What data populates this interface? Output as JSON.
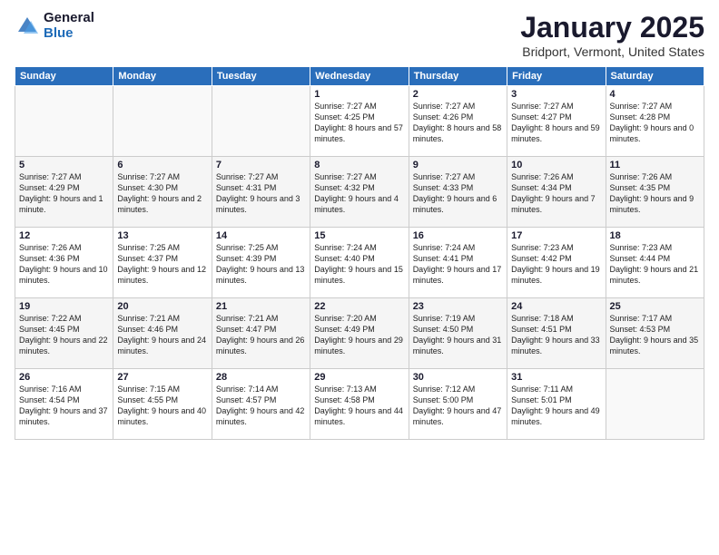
{
  "logo": {
    "general": "General",
    "blue": "Blue"
  },
  "header": {
    "title": "January 2025",
    "subtitle": "Bridport, Vermont, United States"
  },
  "weekdays": [
    "Sunday",
    "Monday",
    "Tuesday",
    "Wednesday",
    "Thursday",
    "Friday",
    "Saturday"
  ],
  "weeks": [
    [
      {
        "day": "",
        "info": ""
      },
      {
        "day": "",
        "info": ""
      },
      {
        "day": "",
        "info": ""
      },
      {
        "day": "1",
        "info": "Sunrise: 7:27 AM\nSunset: 4:25 PM\nDaylight: 8 hours and 57 minutes."
      },
      {
        "day": "2",
        "info": "Sunrise: 7:27 AM\nSunset: 4:26 PM\nDaylight: 8 hours and 58 minutes."
      },
      {
        "day": "3",
        "info": "Sunrise: 7:27 AM\nSunset: 4:27 PM\nDaylight: 8 hours and 59 minutes."
      },
      {
        "day": "4",
        "info": "Sunrise: 7:27 AM\nSunset: 4:28 PM\nDaylight: 9 hours and 0 minutes."
      }
    ],
    [
      {
        "day": "5",
        "info": "Sunrise: 7:27 AM\nSunset: 4:29 PM\nDaylight: 9 hours and 1 minute."
      },
      {
        "day": "6",
        "info": "Sunrise: 7:27 AM\nSunset: 4:30 PM\nDaylight: 9 hours and 2 minutes."
      },
      {
        "day": "7",
        "info": "Sunrise: 7:27 AM\nSunset: 4:31 PM\nDaylight: 9 hours and 3 minutes."
      },
      {
        "day": "8",
        "info": "Sunrise: 7:27 AM\nSunset: 4:32 PM\nDaylight: 9 hours and 4 minutes."
      },
      {
        "day": "9",
        "info": "Sunrise: 7:27 AM\nSunset: 4:33 PM\nDaylight: 9 hours and 6 minutes."
      },
      {
        "day": "10",
        "info": "Sunrise: 7:26 AM\nSunset: 4:34 PM\nDaylight: 9 hours and 7 minutes."
      },
      {
        "day": "11",
        "info": "Sunrise: 7:26 AM\nSunset: 4:35 PM\nDaylight: 9 hours and 9 minutes."
      }
    ],
    [
      {
        "day": "12",
        "info": "Sunrise: 7:26 AM\nSunset: 4:36 PM\nDaylight: 9 hours and 10 minutes."
      },
      {
        "day": "13",
        "info": "Sunrise: 7:25 AM\nSunset: 4:37 PM\nDaylight: 9 hours and 12 minutes."
      },
      {
        "day": "14",
        "info": "Sunrise: 7:25 AM\nSunset: 4:39 PM\nDaylight: 9 hours and 13 minutes."
      },
      {
        "day": "15",
        "info": "Sunrise: 7:24 AM\nSunset: 4:40 PM\nDaylight: 9 hours and 15 minutes."
      },
      {
        "day": "16",
        "info": "Sunrise: 7:24 AM\nSunset: 4:41 PM\nDaylight: 9 hours and 17 minutes."
      },
      {
        "day": "17",
        "info": "Sunrise: 7:23 AM\nSunset: 4:42 PM\nDaylight: 9 hours and 19 minutes."
      },
      {
        "day": "18",
        "info": "Sunrise: 7:23 AM\nSunset: 4:44 PM\nDaylight: 9 hours and 21 minutes."
      }
    ],
    [
      {
        "day": "19",
        "info": "Sunrise: 7:22 AM\nSunset: 4:45 PM\nDaylight: 9 hours and 22 minutes."
      },
      {
        "day": "20",
        "info": "Sunrise: 7:21 AM\nSunset: 4:46 PM\nDaylight: 9 hours and 24 minutes."
      },
      {
        "day": "21",
        "info": "Sunrise: 7:21 AM\nSunset: 4:47 PM\nDaylight: 9 hours and 26 minutes."
      },
      {
        "day": "22",
        "info": "Sunrise: 7:20 AM\nSunset: 4:49 PM\nDaylight: 9 hours and 29 minutes."
      },
      {
        "day": "23",
        "info": "Sunrise: 7:19 AM\nSunset: 4:50 PM\nDaylight: 9 hours and 31 minutes."
      },
      {
        "day": "24",
        "info": "Sunrise: 7:18 AM\nSunset: 4:51 PM\nDaylight: 9 hours and 33 minutes."
      },
      {
        "day": "25",
        "info": "Sunrise: 7:17 AM\nSunset: 4:53 PM\nDaylight: 9 hours and 35 minutes."
      }
    ],
    [
      {
        "day": "26",
        "info": "Sunrise: 7:16 AM\nSunset: 4:54 PM\nDaylight: 9 hours and 37 minutes."
      },
      {
        "day": "27",
        "info": "Sunrise: 7:15 AM\nSunset: 4:55 PM\nDaylight: 9 hours and 40 minutes."
      },
      {
        "day": "28",
        "info": "Sunrise: 7:14 AM\nSunset: 4:57 PM\nDaylight: 9 hours and 42 minutes."
      },
      {
        "day": "29",
        "info": "Sunrise: 7:13 AM\nSunset: 4:58 PM\nDaylight: 9 hours and 44 minutes."
      },
      {
        "day": "30",
        "info": "Sunrise: 7:12 AM\nSunset: 5:00 PM\nDaylight: 9 hours and 47 minutes."
      },
      {
        "day": "31",
        "info": "Sunrise: 7:11 AM\nSunset: 5:01 PM\nDaylight: 9 hours and 49 minutes."
      },
      {
        "day": "",
        "info": ""
      }
    ]
  ]
}
